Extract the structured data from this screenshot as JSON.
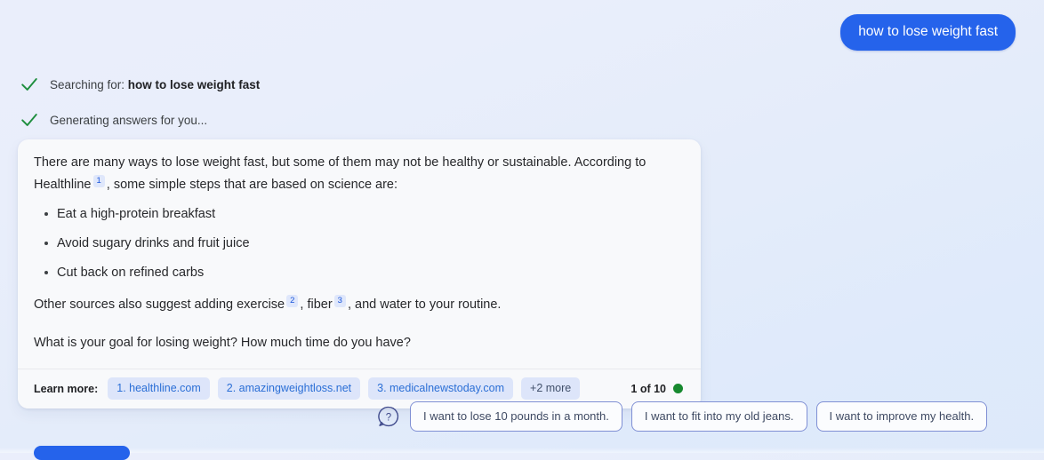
{
  "user_query": {
    "text": "how to lose weight fast",
    "bubble_color": "#2563eb"
  },
  "status": {
    "items": [
      {
        "label_prefix": "Searching for: ",
        "label_bold": "how to lose weight fast",
        "icon": "check-icon",
        "icon_color": "#1e8e3e"
      },
      {
        "label_prefix": "Generating answers for you...",
        "label_bold": "",
        "icon": "check-icon",
        "icon_color": "#1e8e3e"
      }
    ]
  },
  "answer": {
    "paragraph_1_a": "There are many ways to lose weight fast, but some of them may not be healthy or sustainable. According to Healthline",
    "citation_1": "1",
    "paragraph_1_b": ", some simple steps that are based on science are:",
    "bullets": [
      "Eat a high-protein breakfast",
      "Avoid sugary drinks and fruit juice",
      "Cut back on refined carbs"
    ],
    "paragraph_2_a": "Other sources also suggest adding exercise",
    "citation_2": "2",
    "paragraph_2_b": ", fiber",
    "citation_3": "3",
    "paragraph_2_c": ", and water to your routine.",
    "paragraph_3": "What is your goal for losing weight? How much time do you have?"
  },
  "footer": {
    "learn_more_label": "Learn more:",
    "sources": [
      "1. healthline.com",
      "2. amazingweightloss.net",
      "3. medicalnewstoday.com"
    ],
    "more_label": "+2 more",
    "page_count": "1 of 10",
    "status_dot_color": "#17892f"
  },
  "suggestions": {
    "icon": "question-bubble-icon",
    "chips": [
      "I want to lose 10 pounds in a month.",
      "I want to fit into my old jeans.",
      "I want to improve my health."
    ]
  }
}
